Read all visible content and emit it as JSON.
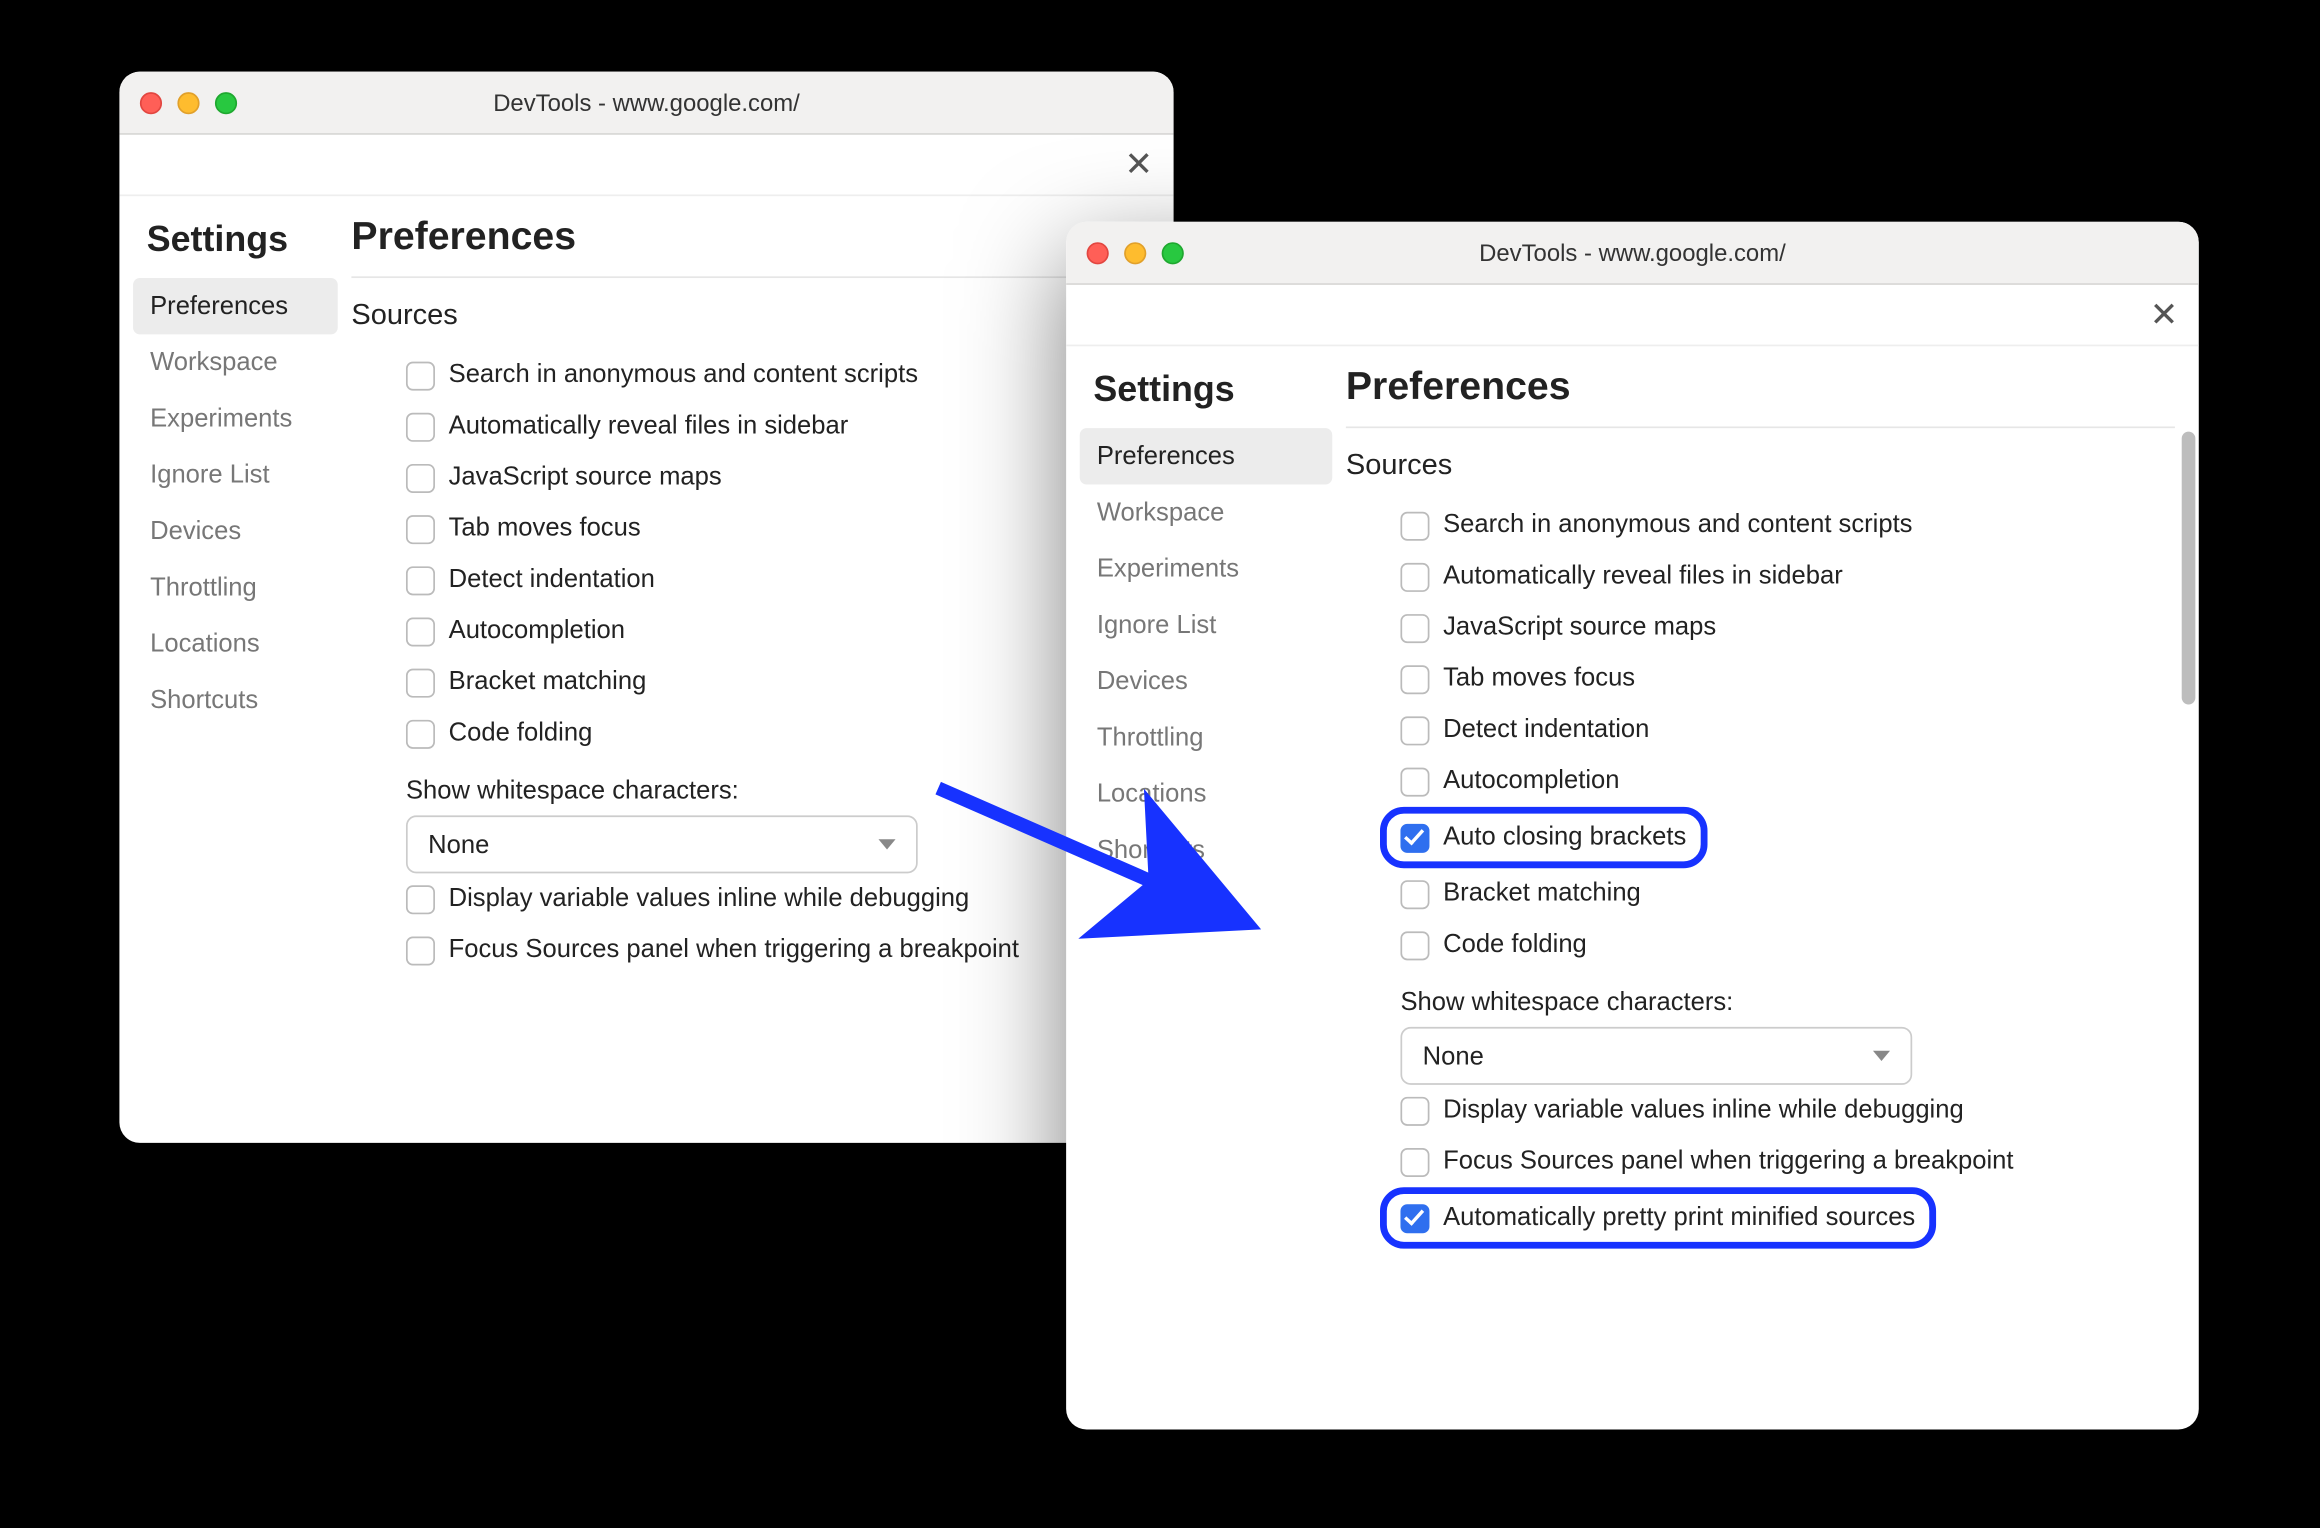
{
  "colors": {
    "highlight": "#1732ff",
    "accent_checkbox": "#2f6fef"
  },
  "window_back": {
    "title": "DevTools - www.google.com/",
    "sidebar": {
      "heading": "Settings",
      "items": [
        "Preferences",
        "Workspace",
        "Experiments",
        "Ignore List",
        "Devices",
        "Throttling",
        "Locations",
        "Shortcuts"
      ],
      "active_index": 0
    },
    "pane": {
      "heading": "Preferences",
      "section": "Sources",
      "options": [
        {
          "label": "Search in anonymous and content scripts",
          "checked": false
        },
        {
          "label": "Automatically reveal files in sidebar",
          "checked": false
        },
        {
          "label": "JavaScript source maps",
          "checked": false
        },
        {
          "label": "Tab moves focus",
          "checked": false
        },
        {
          "label": "Detect indentation",
          "checked": false
        },
        {
          "label": "Autocompletion",
          "checked": false
        },
        {
          "label": "Bracket matching",
          "checked": false
        },
        {
          "label": "Code folding",
          "checked": false
        }
      ],
      "whitespace_label": "Show whitespace characters:",
      "whitespace_value": "None",
      "options_tail": [
        {
          "label": "Display variable values inline while debugging",
          "checked": false
        },
        {
          "label": "Focus Sources panel when triggering a breakpoint",
          "checked": false
        }
      ]
    }
  },
  "window_front": {
    "title": "DevTools - www.google.com/",
    "sidebar": {
      "heading": "Settings",
      "items": [
        "Preferences",
        "Workspace",
        "Experiments",
        "Ignore List",
        "Devices",
        "Throttling",
        "Locations",
        "Shortcuts"
      ],
      "active_index": 0
    },
    "pane": {
      "heading": "Preferences",
      "section": "Sources",
      "options": [
        {
          "label": "Search in anonymous and content scripts",
          "checked": false,
          "highlight": false
        },
        {
          "label": "Automatically reveal files in sidebar",
          "checked": false,
          "highlight": false
        },
        {
          "label": "JavaScript source maps",
          "checked": false,
          "highlight": false
        },
        {
          "label": "Tab moves focus",
          "checked": false,
          "highlight": false
        },
        {
          "label": "Detect indentation",
          "checked": false,
          "highlight": false
        },
        {
          "label": "Autocompletion",
          "checked": false,
          "highlight": false
        },
        {
          "label": "Auto closing brackets",
          "checked": true,
          "highlight": true
        },
        {
          "label": "Bracket matching",
          "checked": false,
          "highlight": false
        },
        {
          "label": "Code folding",
          "checked": false,
          "highlight": false
        }
      ],
      "whitespace_label": "Show whitespace characters:",
      "whitespace_value": "None",
      "options_tail": [
        {
          "label": "Display variable values inline while debugging",
          "checked": false,
          "highlight": false
        },
        {
          "label": "Focus Sources panel when triggering a breakpoint",
          "checked": false,
          "highlight": false
        },
        {
          "label": "Automatically pretty print minified sources",
          "checked": true,
          "highlight": true
        }
      ]
    }
  }
}
